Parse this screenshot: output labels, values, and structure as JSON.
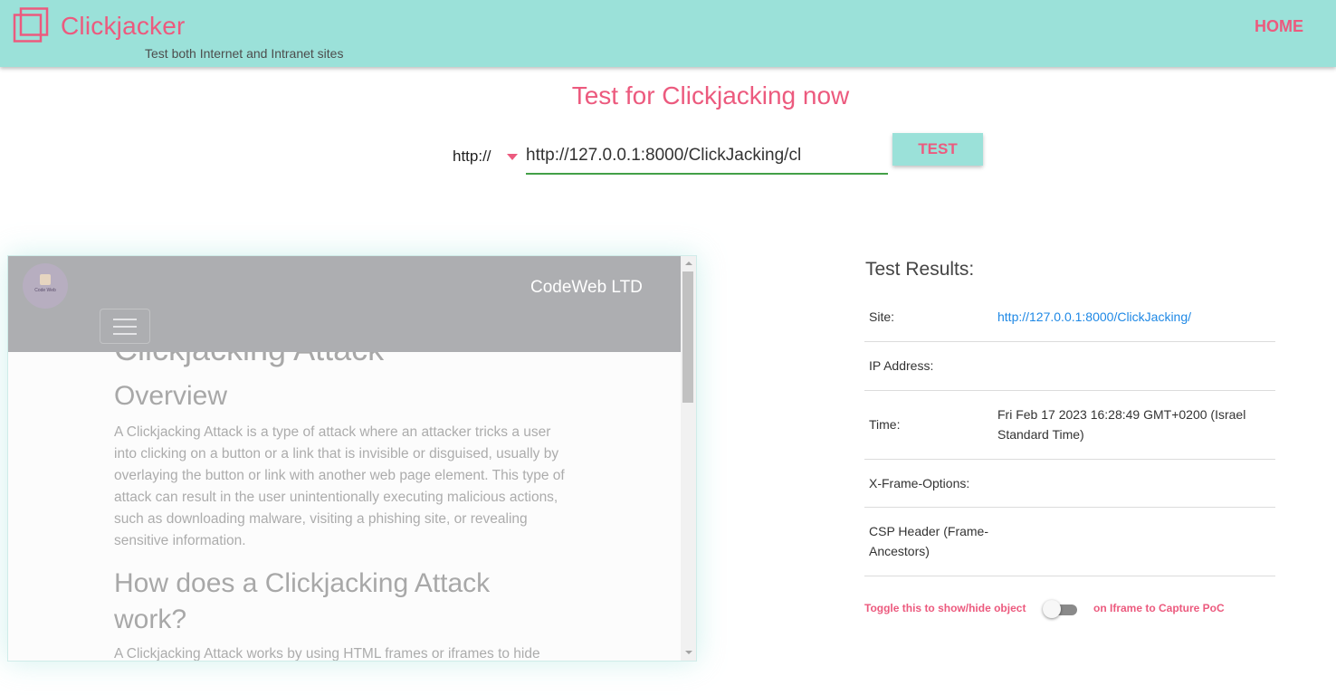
{
  "header": {
    "brand": "Clickjacker",
    "tagline": "Test both Internet and Intranet sites",
    "home_label": "HOME"
  },
  "main": {
    "heading": "Test for Clickjacking now",
    "protocol": "http://",
    "url_value": "http://127.0.0.1:8000/ClickJacking/cl",
    "test_label": "TEST"
  },
  "preview": {
    "company_logo_text": "Code Web",
    "company_name": "CodeWeb LTD",
    "heading_attack": "Clickjacking Attack",
    "heading_overview": "Overview",
    "paragraph1": "A Clickjacking Attack is a type of attack where an attacker tricks a user into clicking on a button or a link that is invisible or disguised, usually by overlaying the button or link with another web page element. This type of attack can result in the user unintentionally executing malicious actions, such as downloading malware, visiting a phishing site, or revealing sensitive information.",
    "heading_how": "How does a Clickjacking Attack work?",
    "paragraph2": "A Clickjacking Attack works by using HTML frames or iframes to hide"
  },
  "results": {
    "title": "Test Results:",
    "rows": [
      {
        "label": "Site:",
        "value": "http://127.0.0.1:8000/ClickJacking/"
      },
      {
        "label": "IP Address:",
        "value": ""
      },
      {
        "label": "Time:",
        "value": "Fri Feb 17 2023 16:28:49 GMT+0200 (Israel Standard Time)"
      },
      {
        "label": "X-Frame-Options:",
        "value": ""
      },
      {
        "label": "CSP Header (Frame-Ancestors)",
        "value": ""
      }
    ],
    "toggle_before": "Toggle this to show/hide object",
    "toggle_after": "on Iframe to Capture PoC",
    "toggle_on": false
  },
  "colors": {
    "accent": "#ec5a7e",
    "header_bg": "#9be1d9",
    "link": "#1e88e5",
    "input_underline": "#43a047"
  }
}
